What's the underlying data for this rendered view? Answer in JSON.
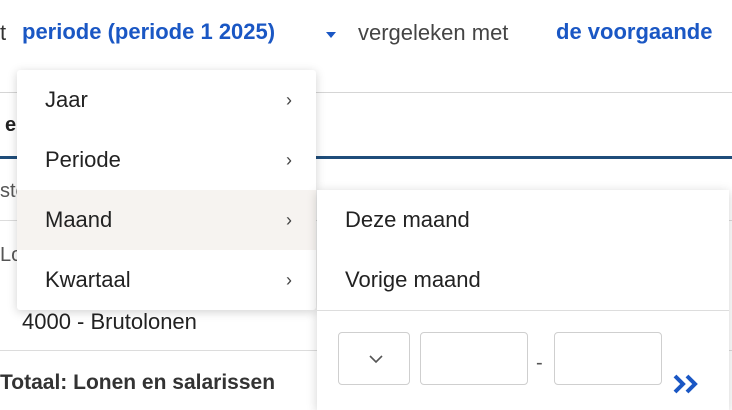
{
  "header": {
    "left_fragment": "t",
    "period_link": "periode (periode 1 2025)",
    "compare_text": "vergeleken met",
    "prev_link": "de voorgaande"
  },
  "report": {
    "header_fragment": "e",
    "row_fragment_1": "ste",
    "row_fragment_2": "Lo",
    "account_row": "4000 - Brutolonen",
    "total_row": "Totaal: Lonen en salarissen"
  },
  "menu": {
    "items": [
      {
        "label": "Jaar",
        "chevron": "›"
      },
      {
        "label": "Periode",
        "chevron": "›"
      },
      {
        "label": "Maand",
        "chevron": "›"
      },
      {
        "label": "Kwartaal",
        "chevron": "›"
      }
    ]
  },
  "submenu": {
    "items": [
      {
        "label": "Deze maand"
      },
      {
        "label": "Vorige maand"
      }
    ],
    "range_separator": "-",
    "from_value": "",
    "to_value": "",
    "go_icon": "double-chevron-right-icon"
  },
  "colors": {
    "link": "#1a57c4",
    "active_item_bg": "#f6f3f0",
    "report_rule": "#1f4d7a"
  }
}
